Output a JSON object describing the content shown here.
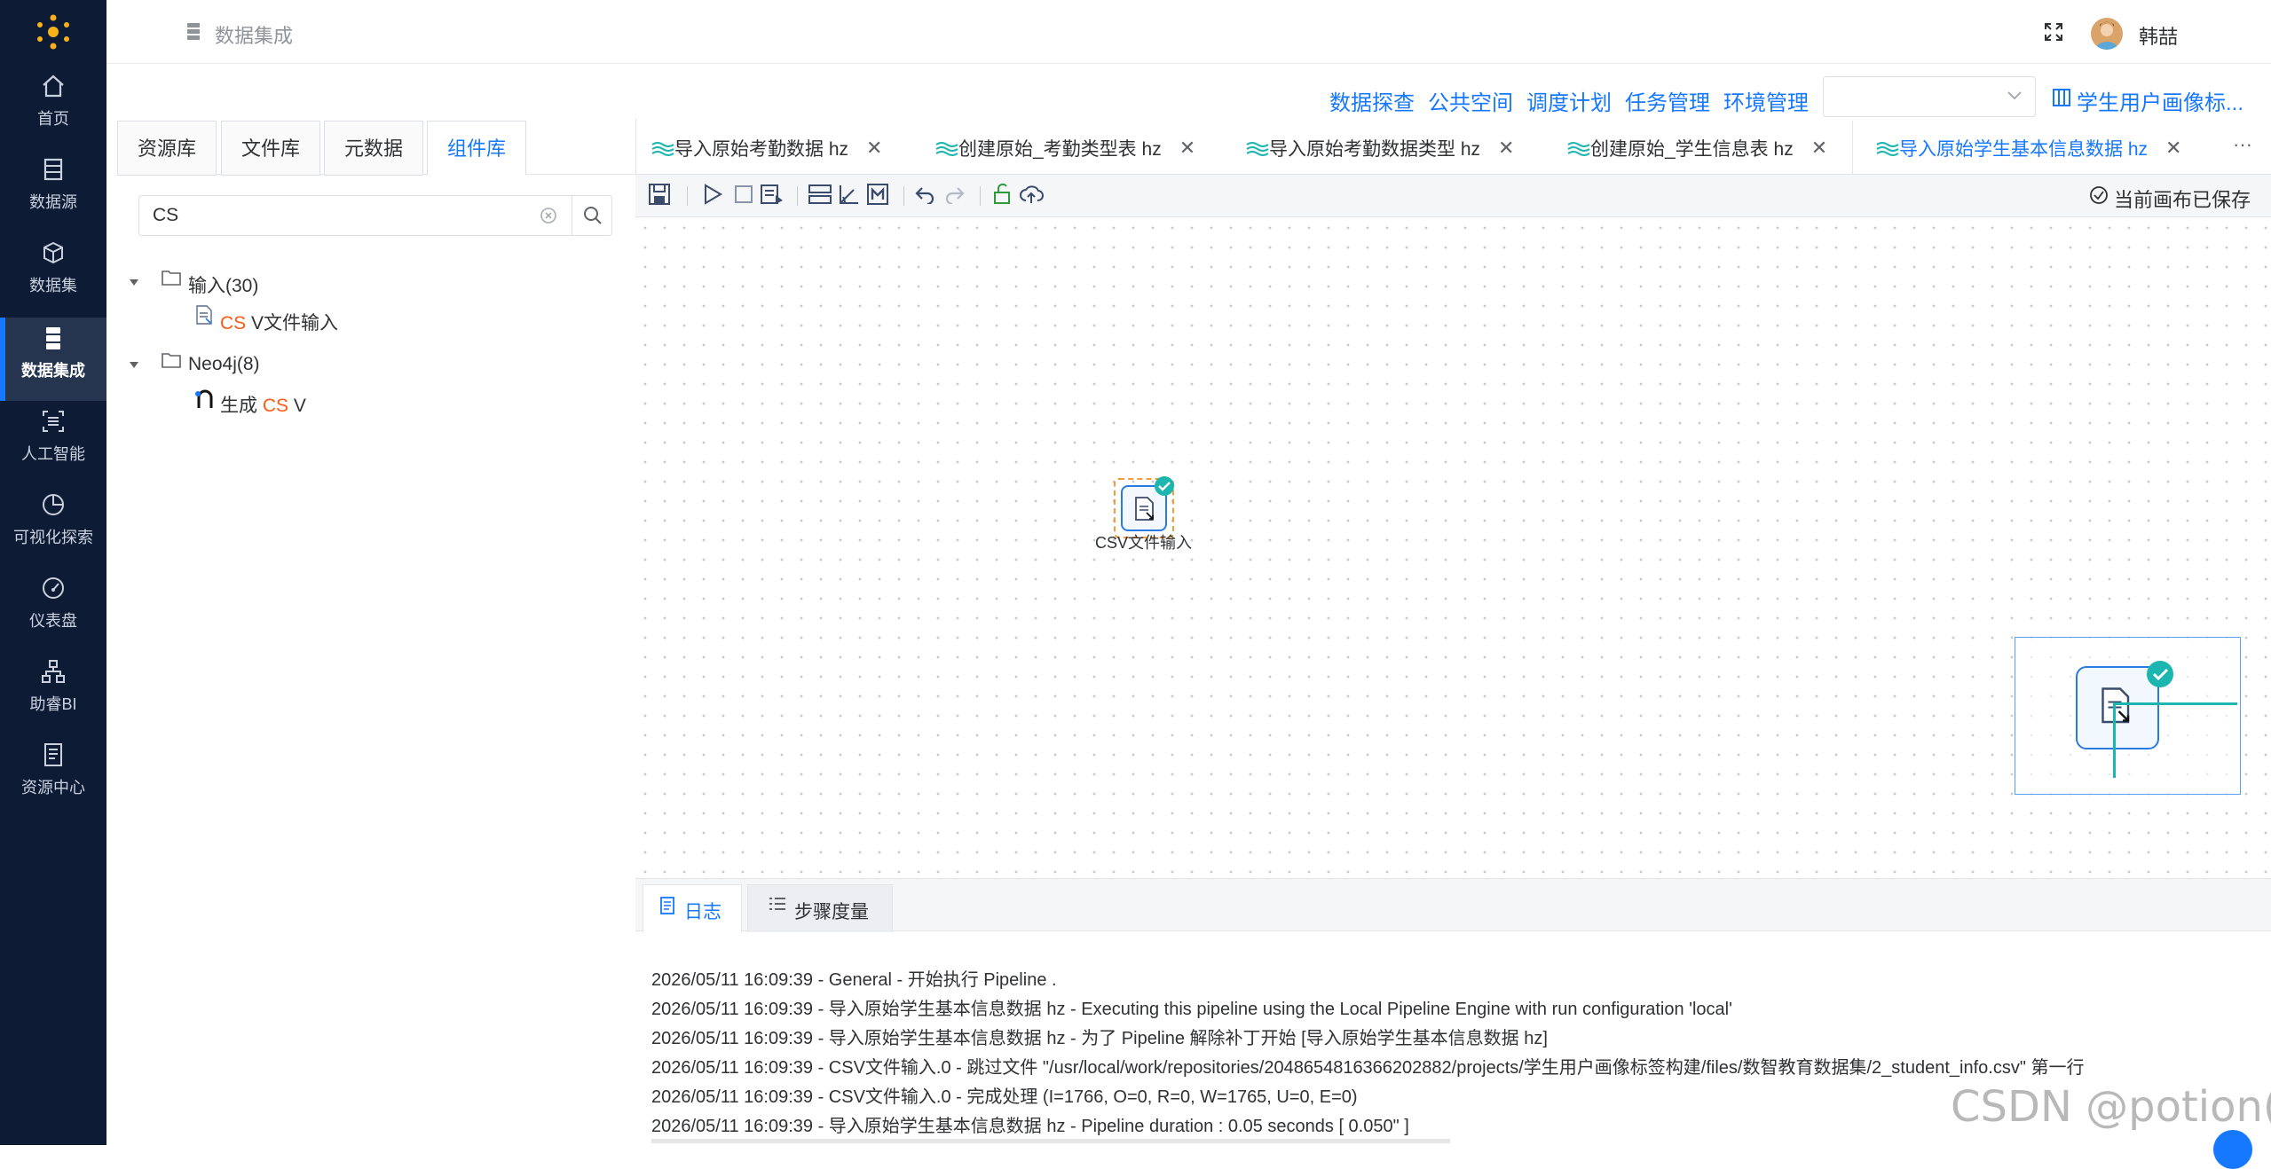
{
  "sidebar": {
    "items": [
      {
        "label": "首页",
        "icon": "home-icon"
      },
      {
        "label": "数据源",
        "icon": "database-icon"
      },
      {
        "label": "数据集",
        "icon": "dataset-cube-icon"
      },
      {
        "label": "数据集成",
        "icon": "integration-server-icon",
        "active": true
      },
      {
        "label": "人工智能",
        "icon": "ai-scan-icon"
      },
      {
        "label": "可视化探索",
        "icon": "pie-chart-icon"
      },
      {
        "label": "仪表盘",
        "icon": "gauge-icon"
      },
      {
        "label": "助睿BI",
        "icon": "org-chart-icon"
      },
      {
        "label": "资源中心",
        "icon": "document-icon"
      }
    ]
  },
  "header": {
    "breadcrumb": "数据集成",
    "user_name": "韩喆"
  },
  "toolbar_links": [
    "数据探查",
    "公共空间",
    "调度计划",
    "任务管理",
    "环境管理"
  ],
  "project_select": {
    "value": ""
  },
  "project_link": "学生用户画像标...",
  "left_panel": {
    "tabs": [
      "资源库",
      "文件库",
      "元数据",
      "组件库"
    ],
    "active_tab": "组件库",
    "search_value": "CS",
    "tree": {
      "group1": "输入(30)",
      "item1_hl": "CS",
      "item1_rest": "V文件输入",
      "group2": "Neo4j(8)",
      "item2_pre": "生成",
      "item2_hl": "CS",
      "item2_rest": "V"
    }
  },
  "editor_tabs": [
    {
      "label": "导入原始考勤数据 hz"
    },
    {
      "label": "创建原始_考勤类型表 hz"
    },
    {
      "label": "导入原始考勤数据类型 hz"
    },
    {
      "label": "创建原始_学生信息表 hz"
    },
    {
      "label": "导入原始学生基本信息数据 hz",
      "active": true
    }
  ],
  "more_label": "···",
  "canvas": {
    "saved_status": "当前画布已保存",
    "node_label": "CSV文件输入"
  },
  "log_panel": {
    "tabs": [
      "日志",
      "步骤度量"
    ],
    "lines": [
      "2026/05/11 16:09:39 - General - 开始执行 Pipeline .",
      "2026/05/11 16:09:39 - 导入原始学生基本信息数据 hz - Executing this pipeline using the Local Pipeline Engine with run configuration 'local'",
      "2026/05/11 16:09:39 - 导入原始学生基本信息数据 hz - 为了 Pipeline 解除补丁开始 [导入原始学生基本信息数据 hz]",
      "2026/05/11 16:09:39 - CSV文件输入.0 - 跳过文件 \"/usr/local/work/repositories/2048654816366202882/projects/学生用户画像标签构建/files/数智教育数据集/2_student_info.csv\" 第一行",
      "2026/05/11 16:09:39 - CSV文件输入.0 - 完成处理 (I=1766, O=0, R=0, W=1765, U=0, E=0)",
      "2026/05/11 16:09:39 - 导入原始学生基本信息数据 hz - Pipeline duration : 0.05 seconds [  0.050\" ]"
    ]
  },
  "watermark": "CSDN @potion()",
  "colors": {
    "sidebar_bg": "#0d1b35",
    "accent": "#1677ff",
    "highlight": "#ff5a12",
    "node_border": "#f39c3c",
    "teal": "#1bb6b0"
  }
}
